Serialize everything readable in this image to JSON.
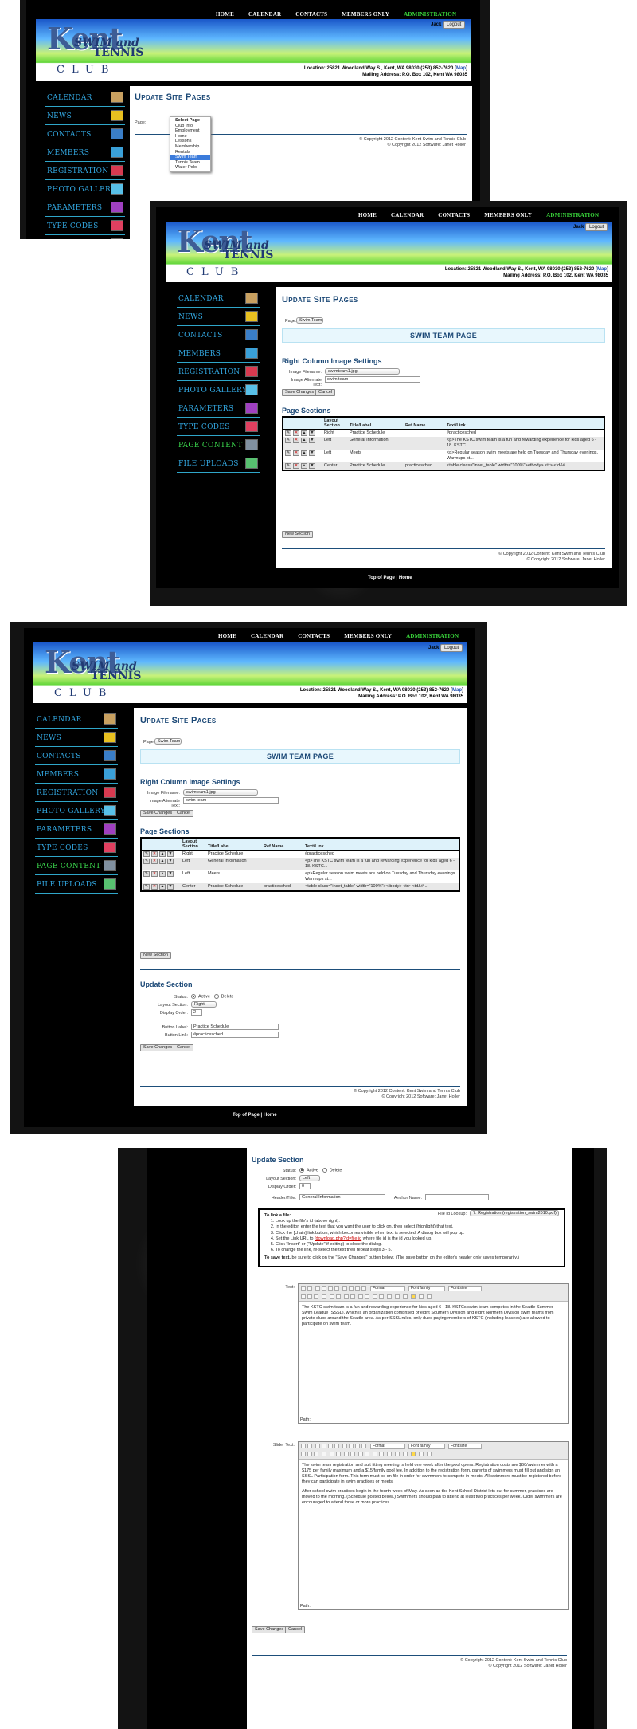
{
  "nav": [
    "HOME",
    "CALENDAR",
    "CONTACTS",
    "MEMBERS ONLY",
    "ADMINISTRATION"
  ],
  "user": "Jack",
  "logout": "Logout",
  "logo": {
    "kent": "Kent",
    "swim": "SWIM and",
    "tennis": "TENNIS",
    "club": "CLUB"
  },
  "address_line1": "Location: 25821 Woodland Way S., Kent, WA 98030 (253) 852-7620 [",
  "map": "Map",
  "address_close": "]",
  "address_line2": "Mailing Address: P.O. Box 102, Kent WA 98035",
  "sidebar": [
    "CALENDAR",
    "NEWS",
    "CONTACTS",
    "MEMBERS",
    "REGISTRATION",
    "PHOTO GALLERY",
    "PARAMETERS",
    "TYPE CODES",
    "PAGE CONTENT",
    "FILE UPLOADS"
  ],
  "sidebar_icon_colors": [
    "#c8a060",
    "#e8c020",
    "#3a7ec8",
    "#3aa0d8",
    "#d83a50",
    "#58c0e8",
    "#a040c0",
    "#e04060",
    "#8090a0",
    "#58c070"
  ],
  "page_title": "Update Site Pages",
  "page_label": "Page:",
  "page_value": "Swim Team",
  "dropdown": [
    "Select Page",
    "Club Info",
    "Employment",
    "Home",
    "Lessons",
    "Membership",
    "Rentals",
    "Swim Team",
    "Tennis Team",
    "Water Polo"
  ],
  "banner": "SWIM TEAM PAGE",
  "right_col": {
    "title": "Right Column Image Settings",
    "filename_label": "Image Filename:",
    "filename": "swimteam1.jpg",
    "alt_label": "Image Alternate Text:",
    "alt": "swim team",
    "save": "Save Changes",
    "cancel": "Cancel"
  },
  "sections": {
    "title": "Page Sections",
    "headers": [
      "Layout Section",
      "Title/Label",
      "Ref Name",
      "Text/Link"
    ],
    "rows": [
      {
        "layout": "Right",
        "title": "Practice Schedule",
        "ref": "",
        "text": "#practicesched"
      },
      {
        "layout": "Left",
        "title": "General Information",
        "ref": "",
        "text": "<p>The KSTC swim team is a fun and rewarding experience for kids aged 6 - 18. KSTC..."
      },
      {
        "layout": "Left",
        "title": "Meets",
        "ref": "",
        "text": "<p>Regular season swim meets are held on Tuesday and Thursday evenings. Warmups st..."
      },
      {
        "layout": "Center",
        "title": "Practice Schedule",
        "ref": "practicesched",
        "text": "<table class=\"inset_table\" width=\"100%\"><tbody> <tr> <td&#..."
      }
    ],
    "new": "New Section"
  },
  "footer": [
    "© Copyright 2012 Content: Kent Swim and Tennis Club",
    "© Copyright 2012 Software: Janet Holler"
  ],
  "top_of_page": "Top of Page",
  "home": "Home",
  "update": {
    "title": "Update Section",
    "status_label": "Status:",
    "active": "Active",
    "delete": "Delete",
    "layout_label": "Layout Section:",
    "layout": "Right",
    "order_label": "Display Order:",
    "order": "2",
    "button_label_label": "Button Label:",
    "button_label": "Practice Schedule",
    "button_link_label": "Button Link:",
    "button_link": "#practicesched",
    "save": "Save Changes",
    "cancel": "Cancel"
  },
  "update2": {
    "title": "Update Section",
    "status_label": "Status:",
    "active": "Active",
    "delete": "Delete",
    "layout_label": "Layout Section:",
    "layout": "Left",
    "order_label": "Display Order:",
    "order": "0",
    "header_label": "Header/Title:",
    "header": "General Information",
    "anchor_label": "Anchor Name:",
    "anchor": "",
    "link_title": "To link a file:",
    "file_lookup_label": "File Id Lookup:",
    "file_lookup": "7: Registration (registration_swim2010.pdf)",
    "steps": [
      "Look up the file's id (above right).",
      "In the editor, enter the text that you want the user to click on, then select (highlight) that text.",
      "Click the [chain] link button, which becomes visible when text is selected. A dialog box will pop up.",
      "Set the Link URL to ",
      "Click \"Insert\" or (\"Update\" if editing) to close the dialog.",
      "To change the link, re-select the text then repeat steps 3 - 5."
    ],
    "step4_link": "/download.php?id=file id",
    "step4_tail": " where file id is the id you looked up.",
    "save_note_bold": "To save text,",
    "save_note": " be sure to click on the \"Save Changes\" button below. (The save button on the editor's header only saves temporarily.)",
    "text_label": "Text:",
    "slider_label": "Slider Text:",
    "format": "Format",
    "font_family": "Font family",
    "font_size": "Font size",
    "text_body": "The KSTC swim team is a fun and rewarding experience for kids aged 6 - 18. KSTCs swim team competes in the Seattle Summer Swim League (SSSL), which is an organization comprised of eight Southern Division and eight Northern Division swim teams from private clubs around the Seattle area. As per SSSL rules, only dues paying members of KSTC (including leasees) are allowed to participate on swim team.",
    "slider_body1": "The swim team registration and suit fitting meeting is held one week after the pool opens. Registration costs are $60/swimmer with a $175 per family maximum and a $15/family pool fee. In addition to the registration form, parents of swimmers must fill out and sign an SSSL Participation form. This form must be on file in order for swimmers to compete in meets. All swimmers must be registered before they can participate in swim practices or meets.",
    "slider_body2": "After school swim practices begin in the fourth week of May. As soon as the Kent School District lets out for summer, practices are moved to the morning. (Schedule posted below.) Swimmers should plan to attend at least two practices per week. Older swimmers are encouraged to attend three or more practices.",
    "path": "Path:",
    "save": "Save Changes",
    "cancel": "Cancel"
  }
}
